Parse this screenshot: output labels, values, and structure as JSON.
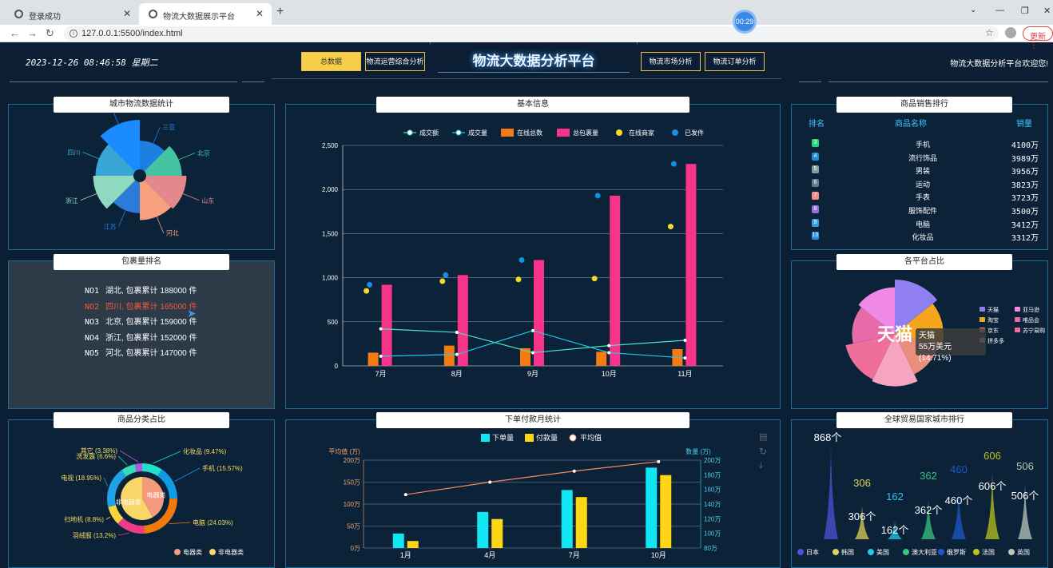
{
  "browser": {
    "tabs": [
      {
        "label": "登录成功"
      },
      {
        "label": "物流大数据展示平台"
      }
    ],
    "url": "127.0.0.1:5500/index.html",
    "timer": "00:29",
    "update_label": "更新"
  },
  "header": {
    "datetime": "2023-12-26  08:46:58  星期二",
    "nav_left": [
      "总数据",
      "物流运营综合分析"
    ],
    "title": "物流大数据分析平台",
    "nav_right": [
      "物流市场分析",
      "物流订单分析"
    ],
    "welcome": "物流大数据分析平台欢迎您!"
  },
  "city_stats": {
    "title": "城市物流数据统计",
    "chart_data": {
      "type": "pie",
      "variant": "rose",
      "categories": [
        "三亚",
        "北京",
        "山东",
        "河北",
        "江苏",
        "浙江",
        "四川",
        "湖北"
      ],
      "colors": [
        "#1d7fe0",
        "#45c4a4",
        "#e4898b",
        "#f6a07d",
        "#2c7bd9",
        "#8fd9c1",
        "#39a7d6",
        "#1a8cff"
      ],
      "radii": [
        0.55,
        0.7,
        0.8,
        0.75,
        0.6,
        0.8,
        0.75,
        1.0
      ]
    }
  },
  "package_rank": {
    "title": "包裹量排名",
    "rows": [
      {
        "no": "NO1",
        "text": "湖北, 包裹累计 188000 件"
      },
      {
        "no": "NO2",
        "text": "四川, 包裹累计 165000 件"
      },
      {
        "no": "NO3",
        "text": "北京, 包裹累计 159000 件"
      },
      {
        "no": "NO4",
        "text": "浙江, 包裹累计 152000 件"
      },
      {
        "no": "NO5",
        "text": "河北, 包裹累计 147000 件"
      }
    ]
  },
  "category": {
    "title": "商品分类占比",
    "chart_data": {
      "type": "pie",
      "variant": "donut-nested",
      "outer": [
        {
          "name": "化妆品",
          "value": 9.47,
          "label": "化妆品 (9.47%)",
          "color": "#22e0c8"
        },
        {
          "name": "手机",
          "value": 15.57,
          "label": "手机 (15.57%)",
          "color": "#0c9de6"
        },
        {
          "name": "电脑",
          "value": 24.03,
          "label": "电脑 (24.03%)",
          "color": "#f17a0d"
        },
        {
          "name": "羽绒服",
          "value": 13.2,
          "label": "羽绒服 (13.2%)",
          "color": "#f03c84"
        },
        {
          "name": "扫地机",
          "value": 8.8,
          "label": "扫地机 (8.8%)",
          "color": "#f7d53d"
        },
        {
          "name": "电视",
          "value": 18.95,
          "label": "电视 (18.95%)",
          "color": "#1fa3e6"
        },
        {
          "name": "洗发露",
          "value": 6.6,
          "label": "洗发露 (6.6%)",
          "color": "#34dcb9"
        },
        {
          "name": "其它",
          "value": 3.38,
          "label": "其它 (3.38%)",
          "color": "#ae58e0"
        }
      ],
      "inner": [
        {
          "name": "电器类",
          "value": 42,
          "color": "#f59a7c"
        },
        {
          "name": "非电器类",
          "value": 58,
          "color": "#f8d66a"
        }
      ],
      "legend": [
        "电器类",
        "非电器类"
      ]
    }
  },
  "basic": {
    "title": "基本信息",
    "chart_data": {
      "type": "bar",
      "categories": [
        "7月",
        "8月",
        "9月",
        "10月",
        "11月"
      ],
      "ylim": [
        0,
        2500
      ],
      "yticks": [
        "2,500",
        "2,000",
        "1,500",
        "1,000",
        "500",
        "0"
      ],
      "series": [
        {
          "name": "成交额",
          "kind": "line",
          "color": "#49e3c0",
          "values": [
            420,
            380,
            150,
            230,
            290
          ]
        },
        {
          "name": "成交量",
          "kind": "line",
          "color": "#1ecbe6",
          "values": [
            110,
            130,
            400,
            150,
            90
          ]
        },
        {
          "name": "在线总数",
          "kind": "bar",
          "color": "#f37b12",
          "values": [
            150,
            230,
            200,
            160,
            190
          ]
        },
        {
          "name": "总包裹量",
          "kind": "bar",
          "color": "#f7338a",
          "values": [
            920,
            1030,
            1200,
            1930,
            2290
          ]
        },
        {
          "name": "在线商家",
          "kind": "point",
          "color": "#f8d92b",
          "values": [
            850,
            960,
            980,
            990,
            1580
          ]
        },
        {
          "name": "已发件",
          "kind": "point",
          "color": "#1a8de0",
          "values": [
            920,
            1030,
            1200,
            1930,
            2290
          ]
        }
      ]
    }
  },
  "sales_rank": {
    "title": "商品销售排行",
    "headers": [
      "排名",
      "商品名称",
      "销量"
    ],
    "rows": [
      {
        "no": "3",
        "name": "手机",
        "value": "4100万",
        "color": "#2bd67b"
      },
      {
        "no": "4",
        "name": "流行饰品",
        "value": "3989万",
        "color": "#1f8cd4"
      },
      {
        "no": "5",
        "name": "男装",
        "value": "3956万",
        "color": "#7aa3a0"
      },
      {
        "no": "6",
        "name": "运动",
        "value": "3823万",
        "color": "#607d8b"
      },
      {
        "no": "7",
        "name": "手表",
        "value": "3723万",
        "color": "#f18d8d"
      },
      {
        "no": "8",
        "name": "服饰配件",
        "value": "3500万",
        "color": "#9b6de0"
      },
      {
        "no": "9",
        "name": "电脑",
        "value": "3412万",
        "color": "#3a9ee0"
      },
      {
        "no": "10",
        "name": "化妆品",
        "value": "3312万",
        "color": "#2a8fe6"
      }
    ]
  },
  "platform": {
    "title": "各平台占比",
    "chart_data": {
      "type": "pie",
      "variant": "rose",
      "slices": [
        {
          "name": "天猫",
          "color": "#8f7ff0",
          "r": 1.0
        },
        {
          "name": "淘宝",
          "color": "#f6a61d",
          "r": 0.85
        },
        {
          "name": "京东",
          "color": "#e98e7c",
          "r": 0.75
        },
        {
          "name": "拼多多",
          "color": "#f7a4c0",
          "r": 0.95
        },
        {
          "name": "苏宁易购",
          "color": "#ee6f9a",
          "r": 0.9
        },
        {
          "name": "唯品会",
          "color": "#e66ba8",
          "r": 0.7
        },
        {
          "name": "亚马逊",
          "color": "#f089e8",
          "r": 0.8
        }
      ],
      "legend": [
        "天猫",
        "亚马逊",
        "淘宝",
        "唯品会",
        "京东",
        "苏宁易购",
        "拼多多"
      ]
    },
    "center_label": "天猫",
    "tooltip_title": "天猫",
    "tooltip_value": "55万美元 (14.71%)"
  },
  "monthly": {
    "title": "下单付款月统计",
    "chart_data": {
      "type": "bar",
      "categories": [
        "1月",
        "4月",
        "7月",
        "10月"
      ],
      "left_axis": {
        "label": "平均值 (万)",
        "ticks": [
          "200万",
          "150万",
          "100万",
          "50万",
          "0万"
        ],
        "range": [
          0,
          200
        ]
      },
      "right_axis": {
        "label": "数量 (万)",
        "ticks": [
          "200万",
          "180万",
          "160万",
          "140万",
          "120万",
          "100万",
          "80万"
        ],
        "range": [
          80,
          200
        ]
      },
      "series": [
        {
          "name": "下单量",
          "kind": "bar",
          "color": "#11e6f2",
          "values": [
            33,
            82,
            132,
            183
          ]
        },
        {
          "name": "付款量",
          "kind": "bar",
          "color": "#ffd615",
          "values": [
            16,
            66,
            116,
            166
          ]
        },
        {
          "name": "平均值",
          "kind": "line",
          "color": "#f58a5b",
          "values": [
            153,
            170,
            185,
            198
          ]
        }
      ]
    }
  },
  "global": {
    "title": "全球贸易国家城市排行",
    "chart_data": {
      "type": "bar",
      "variant": "spike",
      "categories": [
        "日本",
        "韩国",
        "美国",
        "澳大利亚",
        "俄罗斯",
        "法国",
        "英国"
      ],
      "values": [
        868,
        306,
        162,
        362,
        460,
        606,
        506
      ],
      "value_labels": [
        "868个",
        "306个",
        "162个",
        "362个",
        "460个",
        "606个",
        "506个"
      ],
      "colors": [
        "#4a55d9",
        "#e3cf57",
        "#22c9e6",
        "#3cc47f",
        "#1e57c7",
        "#b9c41c",
        "#b8c9b8"
      ]
    }
  }
}
